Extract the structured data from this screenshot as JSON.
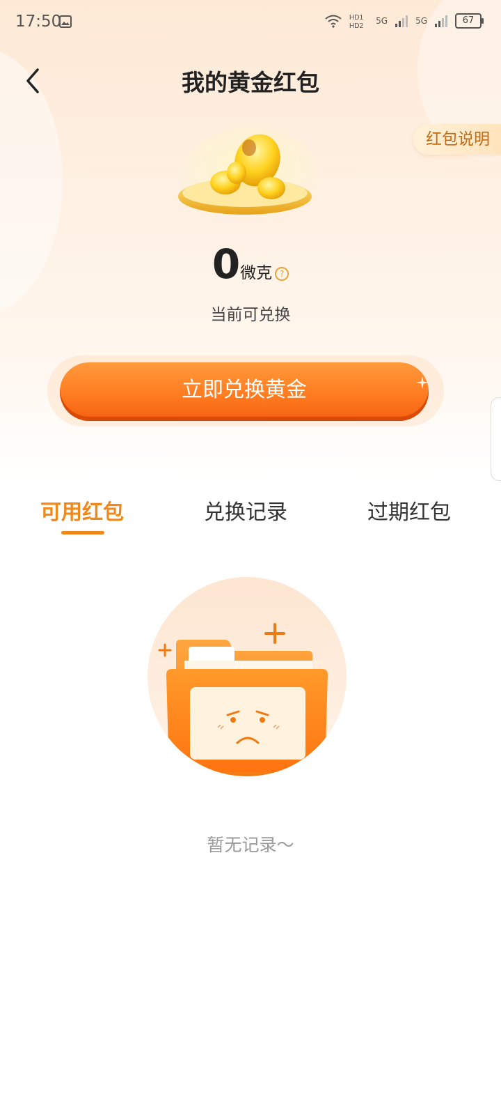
{
  "status_bar": {
    "time": "17:50",
    "network_1": "5G",
    "network_2": "5G",
    "battery": "67"
  },
  "header": {
    "title": "我的黄金红包",
    "help_link": "红包说明"
  },
  "balance": {
    "value": "0",
    "unit": "微克",
    "help_symbol": "?",
    "caption": "当前可兑换"
  },
  "exchange_button": {
    "label": "立即兑换黄金"
  },
  "tabs": [
    {
      "label": "可用红包",
      "active": true
    },
    {
      "label": "兑换记录",
      "active": false
    },
    {
      "label": "过期红包",
      "active": false
    }
  ],
  "empty_state": {
    "message": "暂无记录～"
  },
  "colors": {
    "accent": "#f0891c",
    "button_orange": "#ff7a1f"
  }
}
